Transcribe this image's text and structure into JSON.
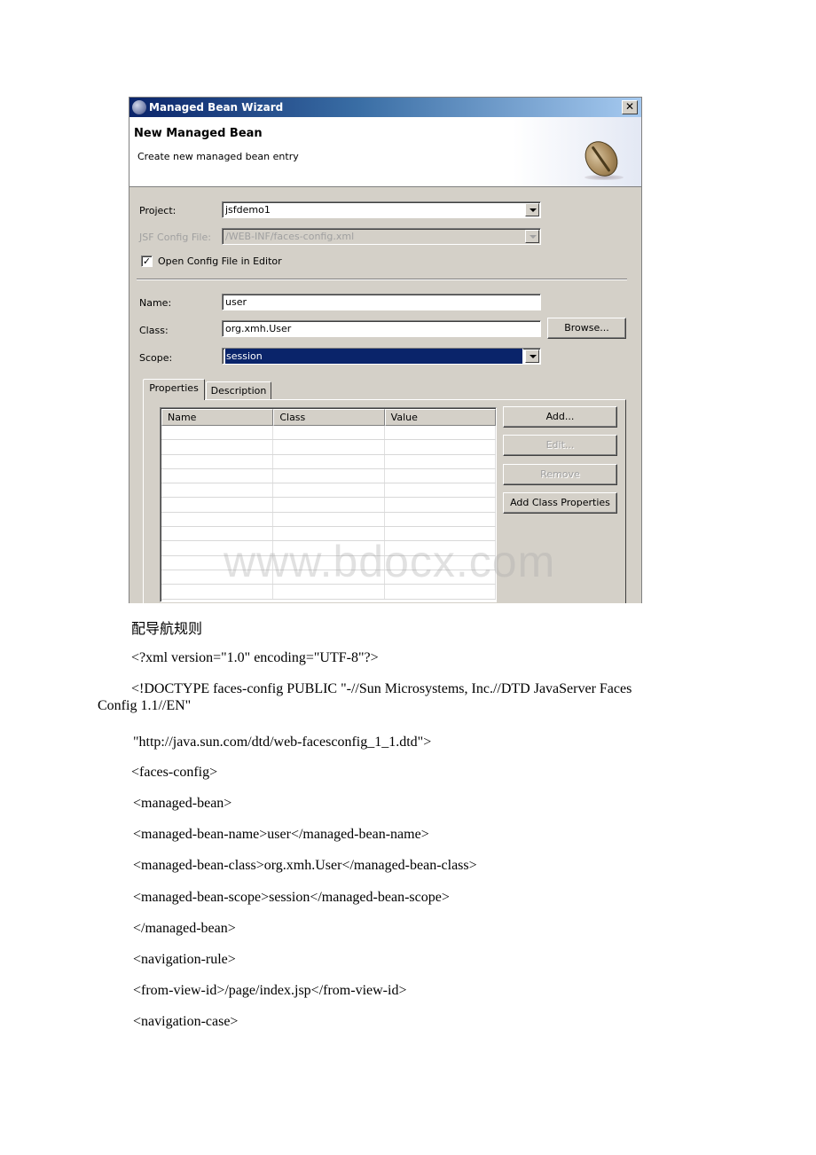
{
  "dialog": {
    "title": "Managed Bean Wizard",
    "header_title": "New Managed Bean",
    "header_subtitle": "Create new managed bean entry",
    "project_label": "Project:",
    "project_value": "jsfdemo1",
    "config_file_label": "JSF Config File:",
    "config_file_value": "/WEB-INF/faces-config.xml",
    "open_in_editor_label": "Open Config File in Editor",
    "open_in_editor_checked": true,
    "name_label": "Name:",
    "name_value": "user",
    "class_label": "Class:",
    "class_value": "org.xmh.User",
    "browse_label": "Browse...",
    "scope_label": "Scope:",
    "scope_value": "session",
    "tabs": [
      {
        "label": "Properties",
        "active": true
      },
      {
        "label": "Description",
        "active": false
      }
    ],
    "table_columns": [
      "Name",
      "Class",
      "Value"
    ],
    "buttons": {
      "add": "Add...",
      "edit": "Edit...",
      "remove": "Remove",
      "add_class_properties": "Add Class Properties"
    }
  },
  "watermark": "www.bdocx.com",
  "document": {
    "lines": [
      "配导航规则",
      "<?xml version=\"1.0\" encoding=\"UTF-8\"?>",
      "<!DOCTYPE faces-config PUBLIC \"-//Sun Microsystems, Inc.//DTD JavaServer Faces",
      "Config 1.1//EN\"",
      "\"http://java.sun.com/dtd/web-facesconfig_1_1.dtd\">",
      "<faces-config>",
      "<managed-bean>",
      "<managed-bean-name>user</managed-bean-name>",
      "<managed-bean-class>org.xmh.User</managed-bean-class>",
      "<managed-bean-scope>session</managed-bean-scope>",
      "</managed-bean>",
      "<navigation-rule>",
      "<from-view-id>/page/index.jsp</from-view-id>",
      "<navigation-case>"
    ]
  }
}
